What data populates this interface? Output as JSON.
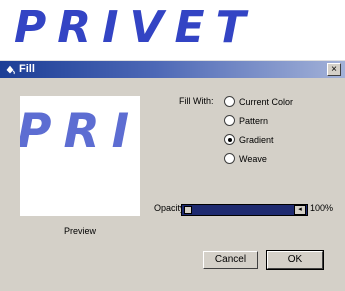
{
  "header": {
    "logo_text": "PRIVET"
  },
  "dialog": {
    "title": "Fill",
    "close_glyph": "×",
    "preview": {
      "text": "PRIV",
      "label": "Preview"
    },
    "fill_with": {
      "label": "Fill With:",
      "options": [
        {
          "label": "Current Color",
          "checked": false
        },
        {
          "label": "Pattern",
          "checked": false
        },
        {
          "label": "Gradient",
          "checked": true
        },
        {
          "label": "Weave",
          "checked": false
        }
      ]
    },
    "opacity": {
      "label": "Opacity",
      "value_text": "100%",
      "value": 1.0
    },
    "buttons": {
      "cancel": "Cancel",
      "ok": "OK"
    }
  },
  "colors": {
    "logo": "#3344c4",
    "titlebar_start": "#1c3e96",
    "titlebar_end": "#a3b2d8",
    "dialog_bg": "#d4d0c8"
  }
}
